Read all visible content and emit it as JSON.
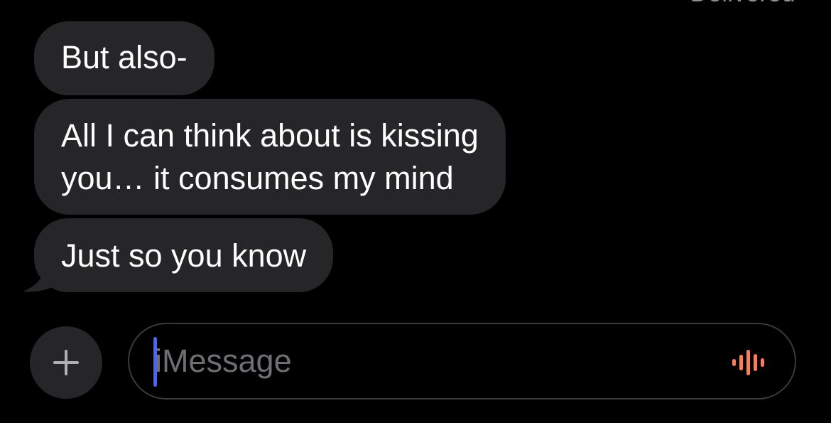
{
  "header": {
    "delivery_status": "Delivered"
  },
  "messages": [
    {
      "text": "But also-"
    },
    {
      "lines": [
        "All I can think about is kissing",
        "you… it consumes my mind"
      ]
    },
    {
      "text": "Just so you know"
    }
  ],
  "composer": {
    "placeholder": "iMessage",
    "value": ""
  },
  "icons": {
    "add": "plus-icon",
    "dictation": "waveform-icon"
  },
  "colors": {
    "background": "#000000",
    "bubble_incoming": "#262628",
    "caret": "#4c66f0",
    "waveform": "#ff7a59"
  }
}
